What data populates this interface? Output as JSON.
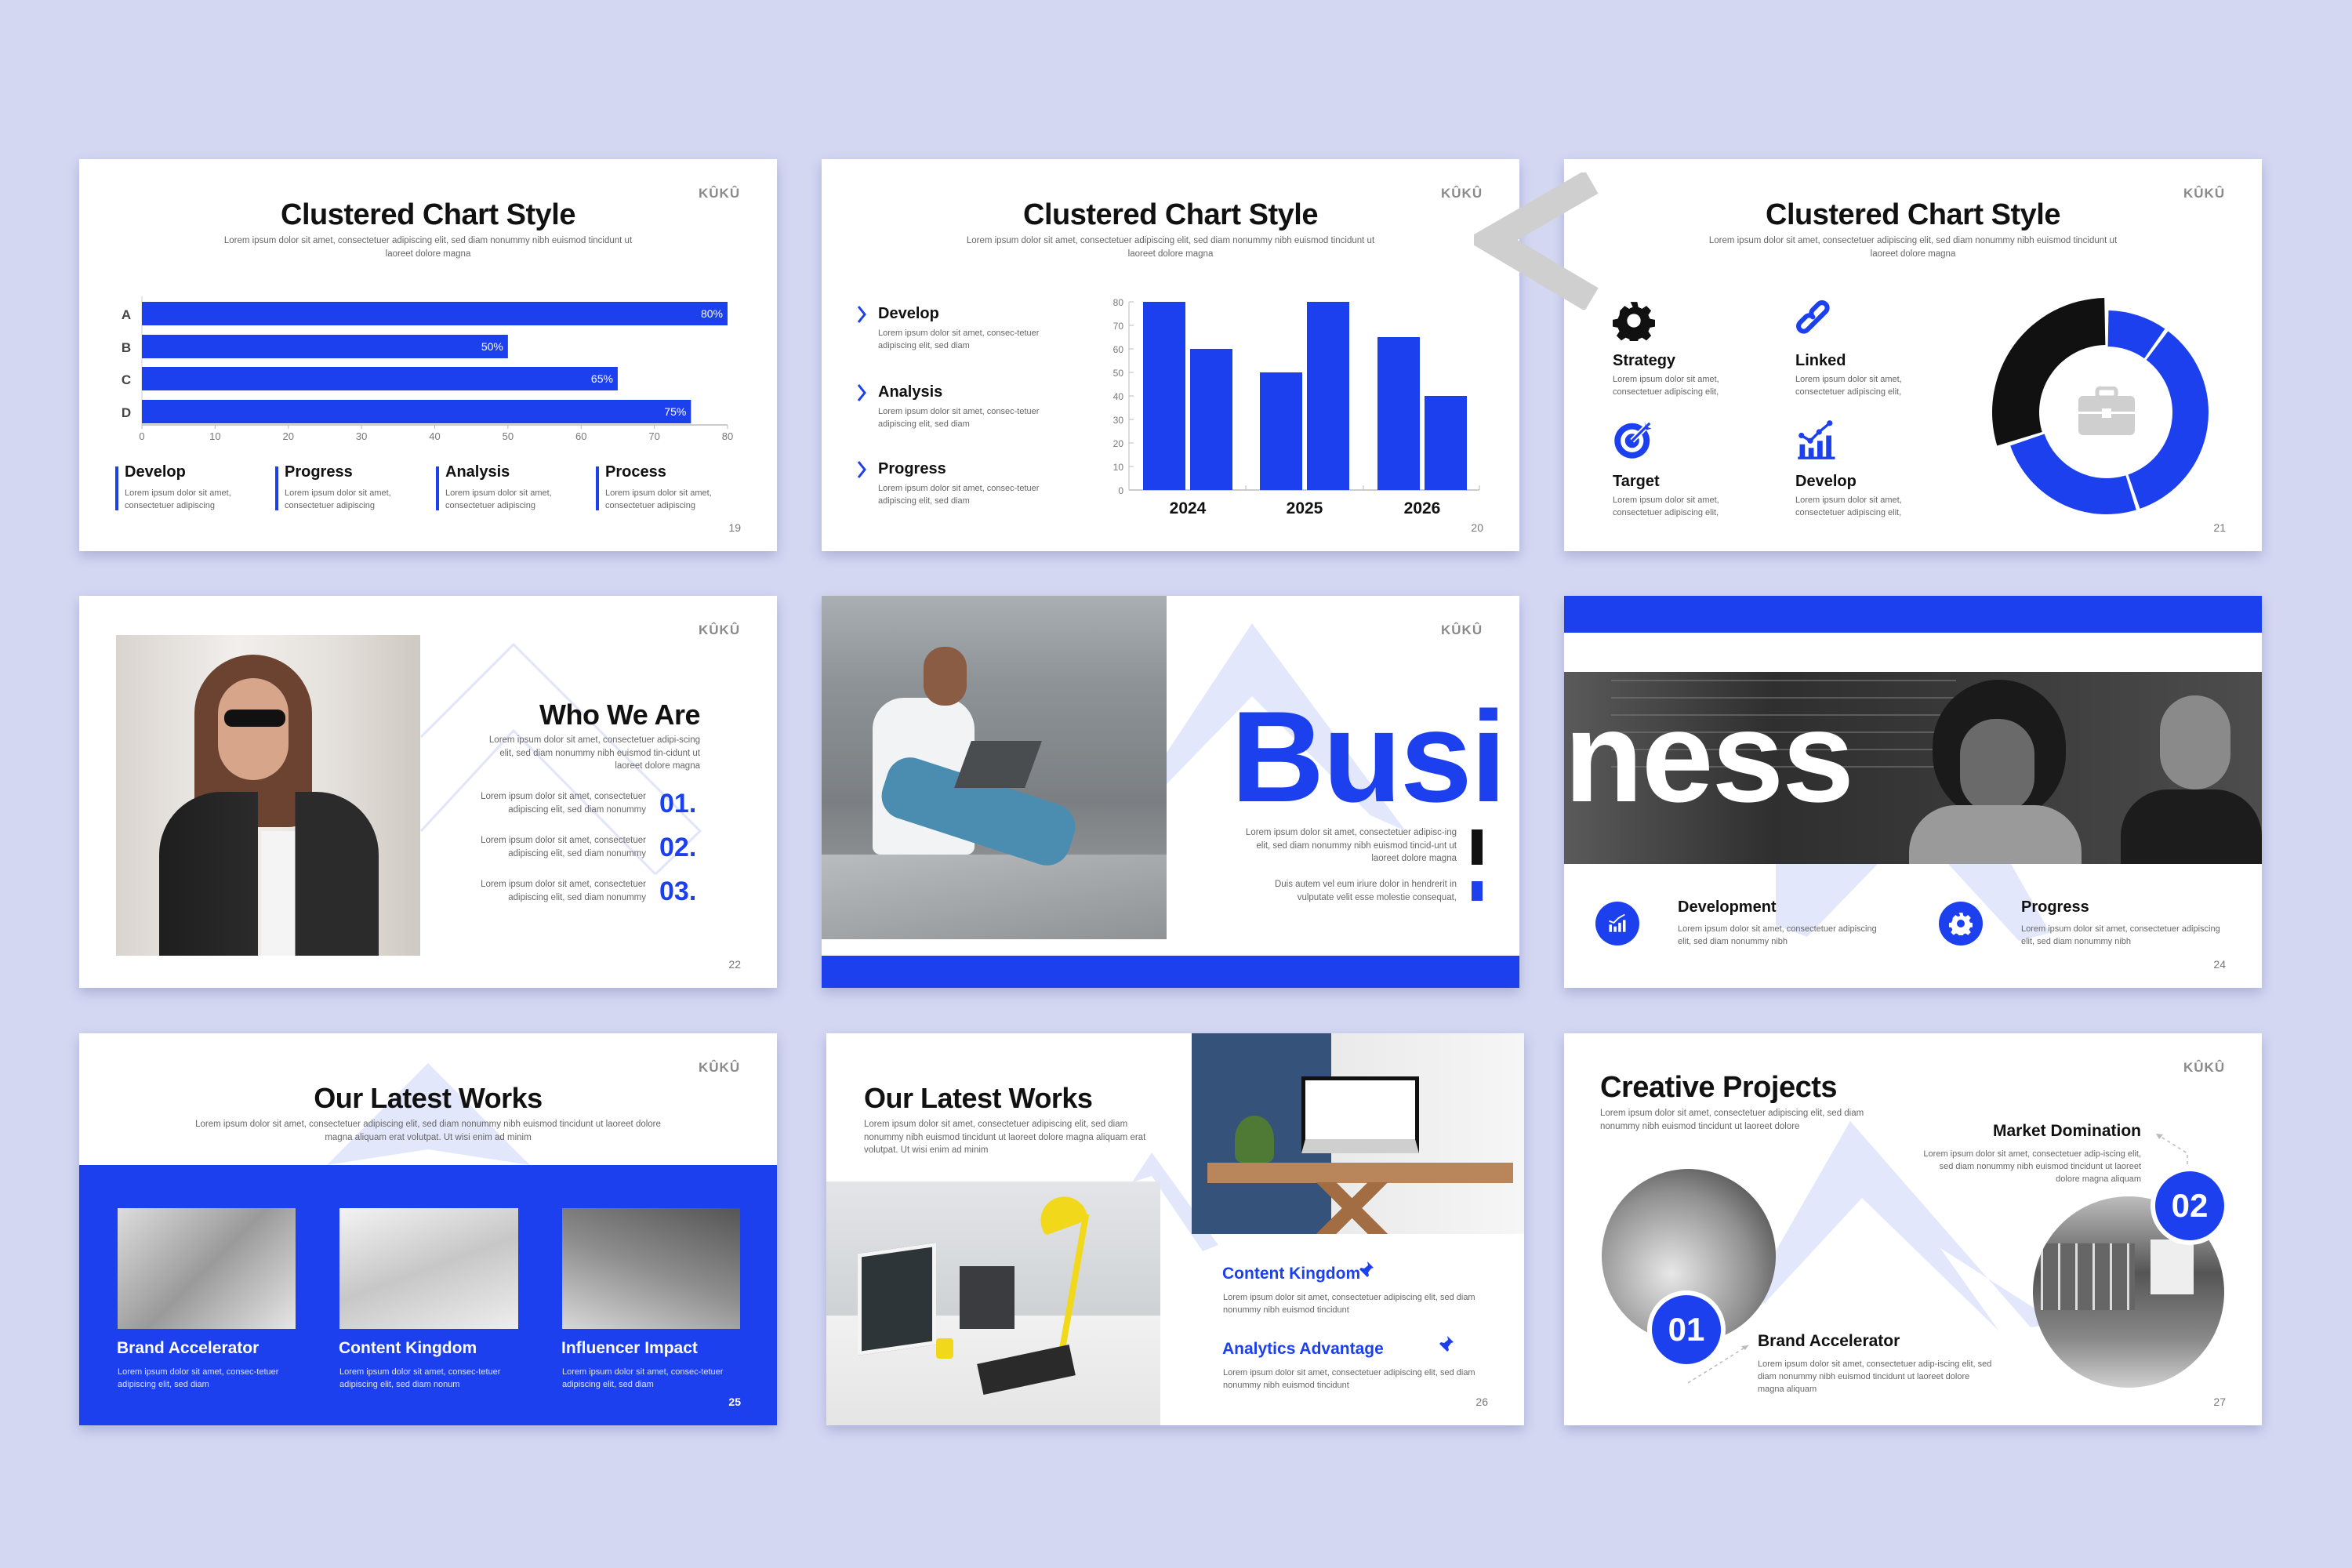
{
  "colors": {
    "background": "#d3d7f2",
    "accent": "#1d40ef",
    "dark": "#111111",
    "pale": "#e3e7fb"
  },
  "logo": "KÛKÛ",
  "s19": {
    "title": "Clustered Chart Style",
    "subtitle": "Lorem ipsum dolor sit amet, consectetuer adipiscing elit, sed diam nonummy nibh euismod tincidunt ut laoreet dolore magna",
    "page": "19",
    "items": [
      {
        "title": "Develop",
        "desc": "Lorem ipsum dolor sit amet, consectetuer adipiscing"
      },
      {
        "title": "Progress",
        "desc": "Lorem ipsum dolor sit amet, consectetuer adipiscing"
      },
      {
        "title": "Analysis",
        "desc": "Lorem ipsum dolor sit amet, consectetuer adipiscing"
      },
      {
        "title": "Process",
        "desc": "Lorem ipsum dolor sit amet, consectetuer adipiscing"
      }
    ]
  },
  "s20": {
    "title": "Clustered Chart Style",
    "subtitle": "Lorem ipsum dolor sit amet, consectetuer adipiscing elit, sed diam nonummy nibh euismod tincidunt ut laoreet dolore magna",
    "page": "20",
    "items": [
      {
        "title": "Develop",
        "desc": "Lorem ipsum dolor sit amet, consec-tetuer adipiscing elit, sed diam"
      },
      {
        "title": "Analysis",
        "desc": "Lorem ipsum dolor sit amet, consec-tetuer adipiscing elit, sed diam"
      },
      {
        "title": "Progress",
        "desc": "Lorem ipsum dolor sit amet, consec-tetuer adipiscing elit, sed diam"
      }
    ]
  },
  "s21": {
    "title": "Clustered Chart Style",
    "subtitle": "Lorem ipsum dolor sit amet, consectetuer adipiscing elit, sed diam nonummy nibh euismod tincidunt ut laoreet dolore magna",
    "page": "21",
    "items": [
      {
        "title": "Strategy",
        "icon": "gear-icon",
        "desc": "Lorem ipsum dolor sit amet, consectetuer adipiscing elit,"
      },
      {
        "title": "Linked",
        "icon": "link-icon",
        "desc": "Lorem ipsum dolor sit amet, consectetuer adipiscing elit,"
      },
      {
        "title": "Target",
        "icon": "target-icon",
        "desc": "Lorem ipsum dolor sit amet, consectetuer adipiscing elit,"
      },
      {
        "title": "Develop",
        "icon": "growth-chart-icon",
        "desc": "Lorem ipsum dolor sit amet, consectetuer adipiscing elit,"
      }
    ]
  },
  "s22": {
    "title": "Who We Are",
    "desc": "Lorem ipsum dolor sit amet, consectetuer adipi-scing elit, sed diam nonummy nibh euismod tin-cidunt ut laoreet dolore magna",
    "page": "22",
    "items": [
      {
        "num": "01.",
        "desc": "Lorem ipsum dolor sit amet, consectetuer adipiscing elit, sed diam nonummy"
      },
      {
        "num": "02.",
        "desc": "Lorem ipsum dolor sit amet, consectetuer adipiscing elit, sed diam nonummy"
      },
      {
        "num": "03.",
        "desc": "Lorem ipsum dolor sit amet, consectetuer adipiscing elit, sed diam nonummy"
      }
    ]
  },
  "s23": {
    "word": "Busi",
    "p1": "Lorem ipsum dolor sit amet, consectetuer adipisc-ing elit, sed diam nonummy nibh euismod tincid-unt ut laoreet dolore magna",
    "p2": "Duis autem vel eum iriure dolor in hendrerit in vulputate velit esse molestie consequat,"
  },
  "s24": {
    "word": "ness",
    "page": "24",
    "items": [
      {
        "title": "Development",
        "icon": "growth-chart-icon",
        "desc": "Lorem ipsum dolor sit amet, consectetuer adipiscing elit, sed diam nonummy nibh"
      },
      {
        "title": "Progress",
        "icon": "gear-icon",
        "desc": "Lorem ipsum dolor sit amet, consectetuer adipiscing elit, sed diam nonummy nibh"
      }
    ]
  },
  "s25": {
    "title": "Our Latest Works",
    "subtitle": "Lorem ipsum dolor sit amet, consectetuer adipiscing elit, sed diam nonummy nibh euismod tincidunt ut laoreet dolore magna aliquam erat volutpat. Ut wisi enim ad minim",
    "page": "25",
    "items": [
      {
        "title": "Brand Accelerator",
        "desc": "Lorem ipsum dolor sit amet, consec-tetuer adipiscing elit, sed diam"
      },
      {
        "title": "Content Kingdom",
        "desc": "Lorem ipsum dolor sit amet, consec-tetuer adipiscing elit, sed diam nonum"
      },
      {
        "title": "Influencer Impact",
        "desc": "Lorem ipsum dolor sit amet, consec-tetuer adipiscing elit, sed diam"
      }
    ]
  },
  "s26": {
    "title": "Our Latest Works",
    "subtitle": "Lorem ipsum dolor sit amet, consectetuer adipiscing elit, sed diam nonummy nibh euismod tincidunt ut laoreet dolore magna aliquam erat volutpat. Ut wisi enim ad minim",
    "page": "26",
    "items": [
      {
        "title": "Content Kingdom",
        "desc": "Lorem ipsum dolor sit amet, consectetuer adipiscing elit, sed diam nonummy nibh euismod tincidunt"
      },
      {
        "title": "Analytics Advantage",
        "desc": "Lorem ipsum dolor sit amet, consectetuer adipiscing elit, sed diam nonummy nibh euismod tincidunt"
      }
    ]
  },
  "s27": {
    "title": "Creative Projects",
    "subtitle": "Lorem ipsum dolor sit amet, consectetuer adipiscing elit, sed diam nonummy nibh euismod tincidunt ut laoreet dolore",
    "page": "27",
    "items": [
      {
        "num": "01",
        "title": "Brand Accelerator",
        "desc": "Lorem ipsum dolor sit amet, consectetuer adip-iscing elit, sed diam nonummy nibh euismod tincidunt ut laoreet dolore magna aliquam"
      },
      {
        "num": "02",
        "title": "Market Domination",
        "desc": "Lorem ipsum dolor sit amet, consectetuer adip-iscing elit, sed diam nonummy nibh euismod tincidunt ut laoreet dolore magna aliquam"
      }
    ]
  },
  "chart_data": [
    {
      "type": "bar",
      "orientation": "horizontal",
      "categories": [
        "A",
        "B",
        "C",
        "D"
      ],
      "values": [
        80,
        50,
        65,
        75
      ],
      "data_labels": [
        "80%",
        "50%",
        "65%",
        "75%"
      ],
      "xlim": [
        0,
        80
      ],
      "xticks": [
        "0",
        "10",
        "20",
        "30",
        "40",
        "50",
        "60",
        "70",
        "80"
      ],
      "grid": false,
      "color": "#1d40ef"
    },
    {
      "type": "bar",
      "orientation": "vertical",
      "categories": [
        "2024",
        "2025",
        "2026"
      ],
      "series": [
        {
          "values": [
            80,
            50,
            65
          ]
        },
        {
          "values": [
            60,
            80,
            40
          ]
        }
      ],
      "ylim": [
        0,
        80
      ],
      "yticks": [
        "0",
        "10",
        "20",
        "30",
        "40",
        "50",
        "60",
        "70",
        "80"
      ],
      "grid": false,
      "color": "#1d40ef"
    },
    {
      "type": "pie",
      "donut": true,
      "values": [
        10,
        35,
        25,
        30
      ],
      "colors": [
        "#1d40ef",
        "#1d40ef",
        "#1d40ef",
        "#111111"
      ],
      "center_icon": "briefcase-icon"
    }
  ]
}
